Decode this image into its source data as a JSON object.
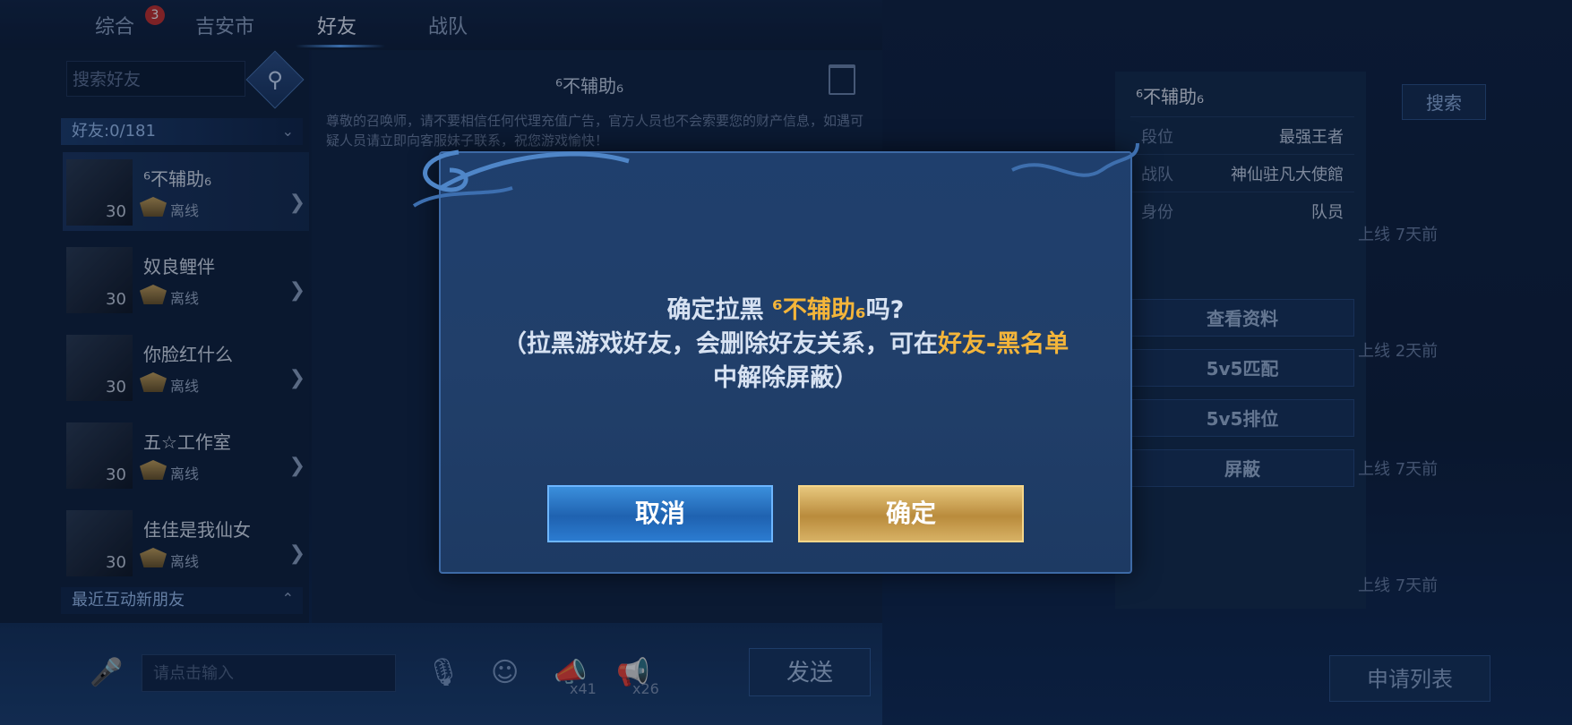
{
  "tabs": {
    "overall": "综合",
    "overall_badge": "3",
    "city": "吉安市",
    "friends": "好友",
    "team": "战队"
  },
  "sidebar": {
    "search_placeholder": "搜索好友",
    "group_label": "好友:0/181",
    "recent_label": "最近互动新朋友",
    "friends": [
      {
        "name": "⁶不辅助₆",
        "level": "30",
        "status": "离线"
      },
      {
        "name": "奴良鲤伴",
        "level": "30",
        "status": "离线"
      },
      {
        "name": "你脸红什么",
        "level": "30",
        "status": "离线"
      },
      {
        "name": "五☆工作室",
        "level": "30",
        "status": "离线"
      },
      {
        "name": "佳佳是我仙女",
        "level": "30",
        "status": "离线"
      }
    ]
  },
  "chat": {
    "title": "⁶不辅助₆",
    "notice": "尊敬的召唤师，请不要相信任何代理充值广告，官方人员也不会索要您的财产信息，如遇可疑人员请立即向客服妹子联系，祝您游戏愉快！",
    "input_placeholder": "请点击输入",
    "count_a": "x41",
    "count_b": "x26",
    "send": "发送"
  },
  "profile": {
    "name": "⁶不辅助₆",
    "rows": [
      {
        "key": "段位",
        "value": "最强王者"
      },
      {
        "key": "战队",
        "value": "神仙驻凡大使館"
      },
      {
        "key": "身份",
        "value": "队员"
      }
    ],
    "buttons": [
      "查看资料",
      "5v5匹配",
      "5v5排位",
      "屏蔽"
    ]
  },
  "far_right": {
    "search": "搜索",
    "online": [
      "上线  7天前",
      "上线  2天前",
      "上线  7天前",
      "上线  7天前"
    ],
    "apply_list": "申请列表"
  },
  "dialog": {
    "line1_prefix": "确定拉黑 ",
    "line1_name": "⁶不辅助₆",
    "line1_suffix": "吗?",
    "line2_prefix": "（拉黑游戏好友，会删除好友关系，可在",
    "line2_highlight": "好友-黑名单",
    "line3": "中解除屏蔽）",
    "cancel": "取消",
    "confirm": "确定"
  },
  "colors": {
    "highlight": "#f4b53a",
    "cancel_button": "#2b7bd0",
    "confirm_button": "#c9a050"
  }
}
